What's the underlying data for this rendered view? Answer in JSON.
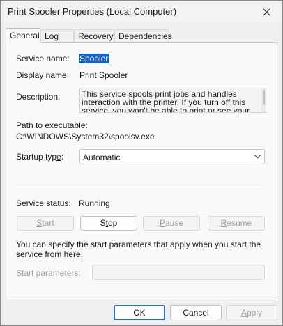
{
  "window": {
    "title": "Print Spooler Properties (Local Computer)"
  },
  "tabs": [
    {
      "label": "General",
      "active": true
    },
    {
      "label": "Log On",
      "active": false
    },
    {
      "label": "Recovery",
      "active": false
    },
    {
      "label": "Dependencies",
      "active": false
    }
  ],
  "general": {
    "service_name_label": "Service name:",
    "service_name": "Spooler",
    "display_name_label": "Display name:",
    "display_name": "Print Spooler",
    "description_label": "Description:",
    "description": "This service spools print jobs and handles interaction with the printer.  If you turn off this service, you won't be able to print or see your printers.",
    "path_label": "Path to executable:",
    "path": "C:\\WINDOWS\\System32\\spoolsv.exe",
    "startup_type_label_pre": "Startup typ",
    "startup_type_label_u": "e",
    "startup_type_label_post": ":",
    "startup_type": "Automatic",
    "status_label": "Service status:",
    "status": "Running",
    "buttons": {
      "start_u": "S",
      "start_rest": "tart",
      "stop_u": "S",
      "stop_t": "t",
      "stop_rest": "op",
      "pause_u": "P",
      "pause_rest": "ause",
      "resume_u": "R",
      "resume_rest": "esume"
    },
    "params_note": "You can specify the start parameters that apply when you start the service from here.",
    "params_label_pre": "Start para",
    "params_label_u": "m",
    "params_label_post": "eters:",
    "params_value": ""
  },
  "dialog_buttons": {
    "ok": "OK",
    "cancel": "Cancel",
    "apply_u": "A",
    "apply_rest": "pply"
  }
}
